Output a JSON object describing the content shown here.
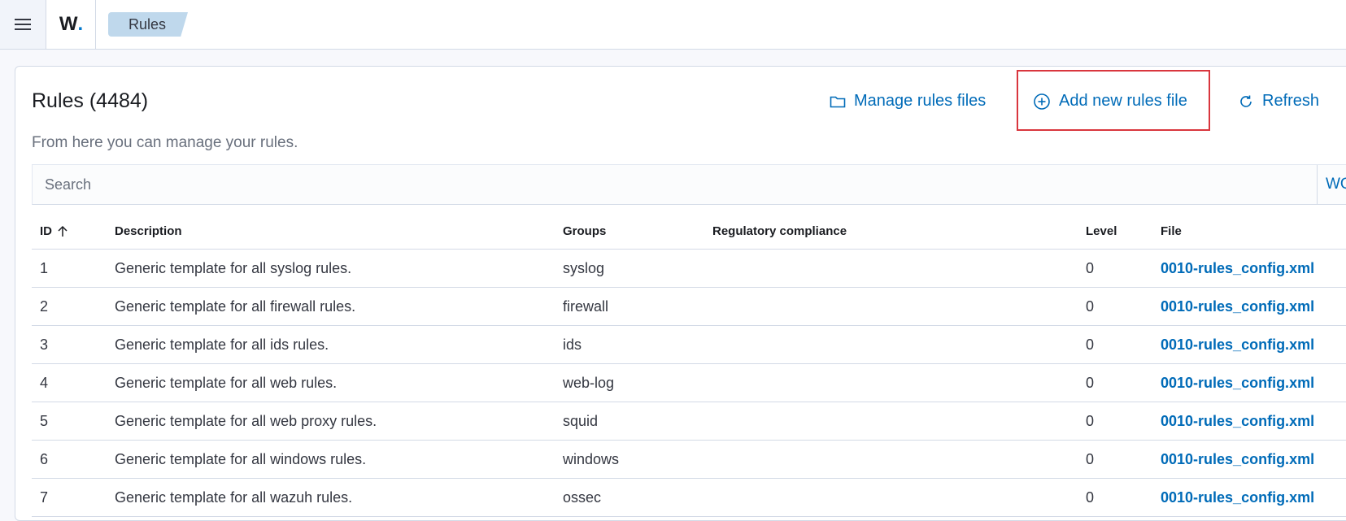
{
  "header": {
    "logo_letter": "W",
    "logo_dot": ".",
    "breadcrumb": "Rules"
  },
  "page": {
    "title": "Rules (4484)",
    "subtitle": "From here you can manage your rules."
  },
  "actions": {
    "manage_label": "Manage rules files",
    "add_label": "Add new rules file",
    "refresh_label": "Refresh"
  },
  "search": {
    "placeholder": "Search",
    "side_label": "WQ"
  },
  "table": {
    "columns": {
      "id": "ID",
      "description": "Description",
      "groups": "Groups",
      "compliance": "Regulatory compliance",
      "level": "Level",
      "file": "File"
    },
    "rows": [
      {
        "id": "1",
        "description": "Generic template for all syslog rules.",
        "groups": "syslog",
        "compliance": "",
        "level": "0",
        "file": "0010-rules_config.xml"
      },
      {
        "id": "2",
        "description": "Generic template for all firewall rules.",
        "groups": "firewall",
        "compliance": "",
        "level": "0",
        "file": "0010-rules_config.xml"
      },
      {
        "id": "3",
        "description": "Generic template for all ids rules.",
        "groups": "ids",
        "compliance": "",
        "level": "0",
        "file": "0010-rules_config.xml"
      },
      {
        "id": "4",
        "description": "Generic template for all web rules.",
        "groups": "web-log",
        "compliance": "",
        "level": "0",
        "file": "0010-rules_config.xml"
      },
      {
        "id": "5",
        "description": "Generic template for all web proxy rules.",
        "groups": "squid",
        "compliance": "",
        "level": "0",
        "file": "0010-rules_config.xml"
      },
      {
        "id": "6",
        "description": "Generic template for all windows rules.",
        "groups": "windows",
        "compliance": "",
        "level": "0",
        "file": "0010-rules_config.xml"
      },
      {
        "id": "7",
        "description": "Generic template for all wazuh rules.",
        "groups": "ossec",
        "compliance": "",
        "level": "0",
        "file": "0010-rules_config.xml"
      }
    ]
  },
  "colors": {
    "accent": "#006bb8",
    "highlight": "#d9363e",
    "breadcrumb_bg": "#bfd8ec"
  },
  "icons": {
    "menu": "hamburger-icon",
    "manage": "folder-icon",
    "add": "plus-circle-icon",
    "refresh": "refresh-icon",
    "sort": "arrow-up-icon"
  }
}
